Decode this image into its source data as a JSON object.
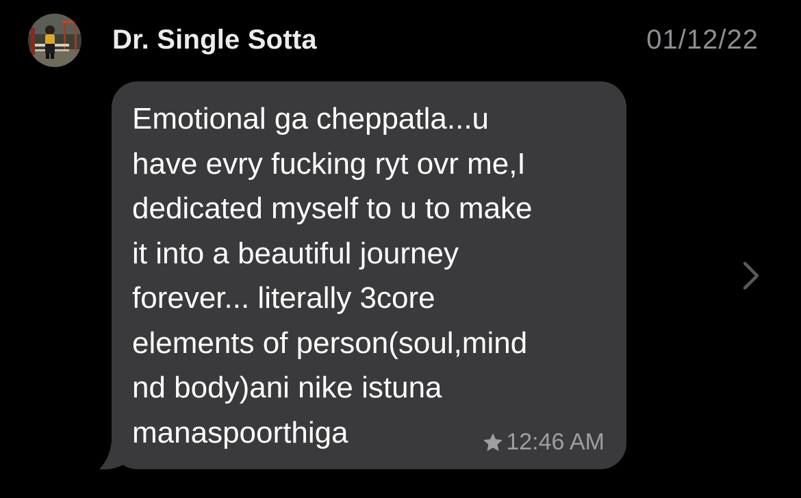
{
  "contact": {
    "name": "Dr. Single Sotta",
    "date": "01/12/22"
  },
  "message": {
    "text": "Emotional ga cheppatla...u\nhave evry fucking ryt ovr me,I\ndedicated myself to u to make\nit into a beautiful journey\nforever... literally 3core\nelements of person(soul,mind\nnd body)ani nike istuna\nmanaspoorthiga",
    "time": "12:46 AM",
    "starred": true
  },
  "icons": {
    "star": "star-icon",
    "chevron": "chevron-right-icon",
    "avatar": "contact-avatar"
  },
  "colors": {
    "background": "#000000",
    "bubble": "#3a3a3c",
    "name": "#ececec",
    "date": "#8e8e93",
    "meta": "#9e9ea4",
    "chevron": "#5a5a5e"
  }
}
